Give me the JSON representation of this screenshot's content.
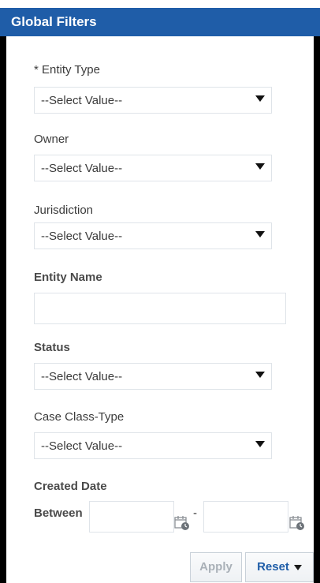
{
  "header": {
    "title": "Global Filters"
  },
  "filters": {
    "entity_type": {
      "label": "* Entity Type",
      "value": "--Select Value--"
    },
    "owner": {
      "label": "Owner",
      "value": "--Select Value--"
    },
    "jurisdiction": {
      "label": "Jurisdiction",
      "value": "--Select Value--"
    },
    "entity_name": {
      "label": "Entity Name",
      "value": ""
    },
    "status": {
      "label": "Status",
      "value": "--Select Value--"
    },
    "case_class_type": {
      "label": "Case Class-Type",
      "value": "--Select Value--"
    },
    "created_date": {
      "label": "Created Date",
      "between_label": "Between",
      "separator": "-",
      "from": "",
      "to": ""
    }
  },
  "actions": {
    "apply": "Apply",
    "reset": "Reset"
  },
  "colors": {
    "header": "#1f5da8",
    "reset_text": "#1f5da8",
    "disabled_text": "#a9b0b7"
  },
  "icons": {
    "calendar": "calendar-icon",
    "dropdown": "chevron-down-icon"
  }
}
